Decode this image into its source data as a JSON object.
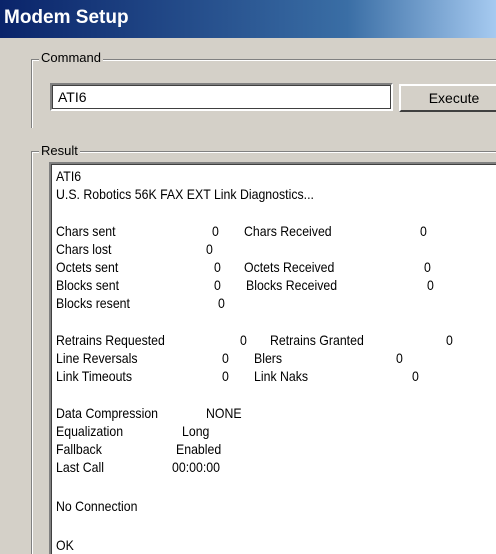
{
  "window": {
    "title": "Modem Setup"
  },
  "command": {
    "group_label": "Command",
    "input_value": "ATI6",
    "execute_label": "Execute"
  },
  "result": {
    "group_label": "Result",
    "lines": {
      "cmd": "ATI6",
      "header": "U.S. Robotics 56K FAX EXT Link Diagnostics...",
      "chars_sent_label": "Chars sent",
      "chars_sent_value": "0",
      "chars_received_label": "Chars Received",
      "chars_received_value": "0",
      "chars_lost_label": "Chars lost",
      "chars_lost_value": "0",
      "octets_sent_label": "Octets sent",
      "octets_sent_value": "0",
      "octets_received_label": "Octets Received",
      "octets_received_value": "0",
      "blocks_sent_label": "Blocks sent",
      "blocks_sent_value": "0",
      "blocks_received_label": "Blocks Received",
      "blocks_received_value": "0",
      "blocks_resent_label": "Blocks resent",
      "blocks_resent_value": "0",
      "retrains_requested_label": "Retrains Requested",
      "retrains_requested_value": "0",
      "retrains_granted_label": "Retrains Granted",
      "retrains_granted_value": "0",
      "line_reversals_label": "Line Reversals",
      "line_reversals_value": "0",
      "blers_label": "Blers",
      "blers_value": "0",
      "link_timeouts_label": "Link Timeouts",
      "link_timeouts_value": "0",
      "link_naks_label": "Link Naks",
      "link_naks_value": "0",
      "data_compression_label": "Data Compression",
      "data_compression_value": "NONE",
      "equalization_label": "Equalization",
      "equalization_value": "Long",
      "fallback_label": "Fallback",
      "fallback_value": "Enabled",
      "last_call_label": "Last Call",
      "last_call_value": "00:00:00",
      "connection_status": "No Connection",
      "ok": "OK"
    }
  }
}
